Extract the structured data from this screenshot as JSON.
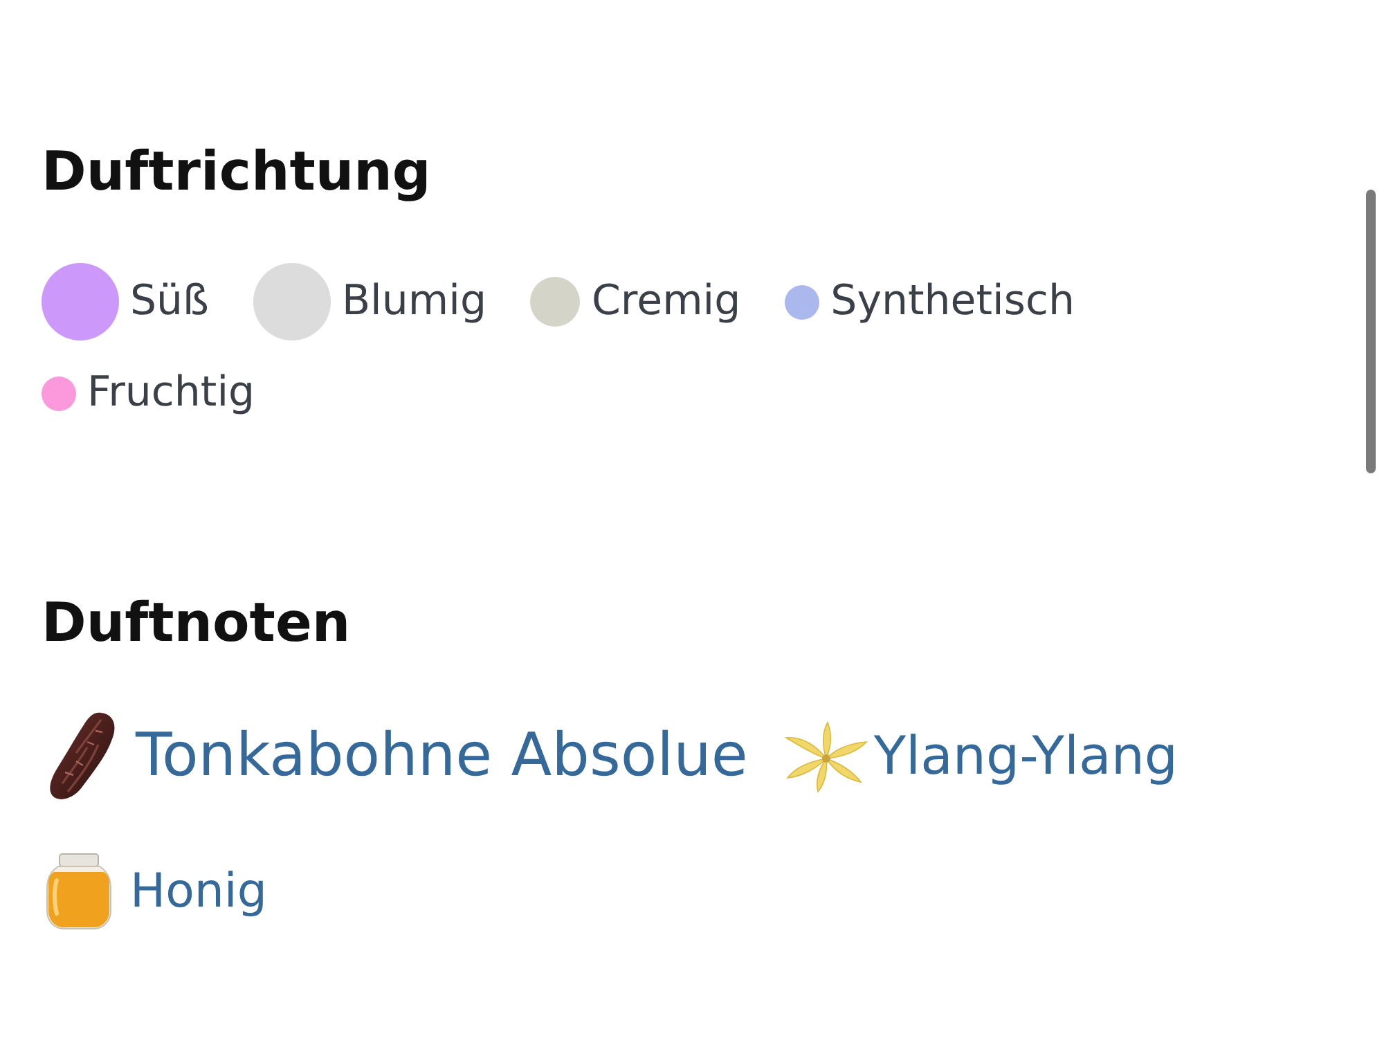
{
  "fragrance_accords": {
    "title": "Duftrichtung",
    "accords": [
      {
        "label": "Süß",
        "color": "#cc99fb",
        "kind": "large"
      },
      {
        "label": "Blumig",
        "color": "#dcdcdc",
        "kind": "large"
      },
      {
        "label": "Cremig",
        "color": "#d4d5c8",
        "kind": "medium"
      },
      {
        "label": "Synthetisch",
        "color": "#abb8ee",
        "kind": "small"
      },
      {
        "label": "Fruchtig",
        "color": "#fb99dc",
        "kind": "small"
      }
    ]
  },
  "fragrance_notes": {
    "title": "Duftnoten",
    "notes": [
      {
        "label": "Tonkabohne Absolue",
        "kind": "large"
      },
      {
        "label": "Ylang-Ylang",
        "kind": "medium"
      },
      {
        "label": "Honig",
        "kind": "small"
      }
    ]
  }
}
